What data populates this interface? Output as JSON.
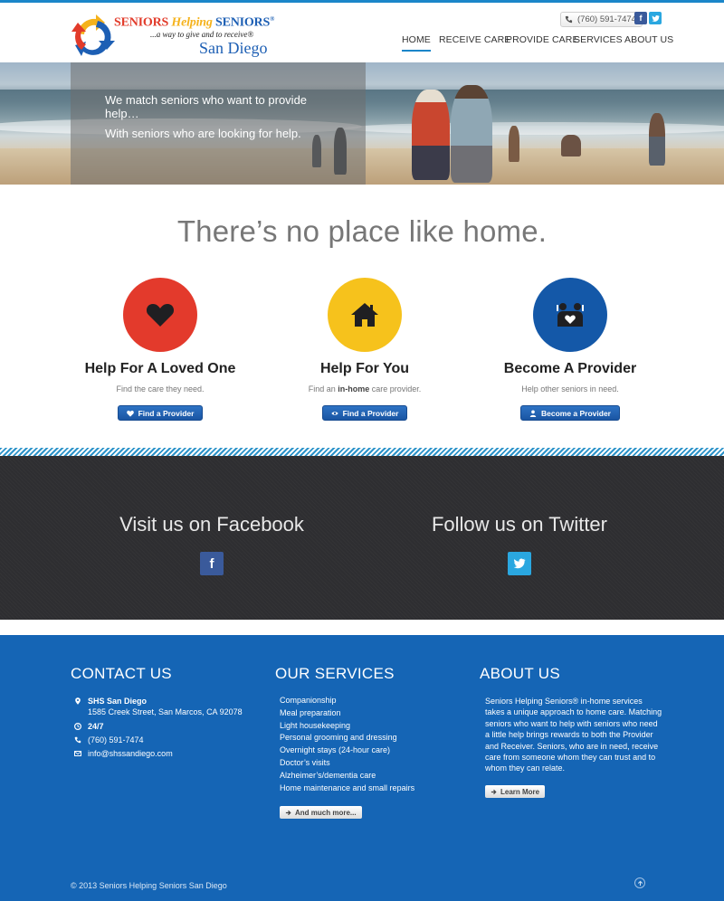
{
  "header": {
    "logo": {
      "word1": "SENIORS",
      "word2": "Helping",
      "word3": "SENIORS",
      "reg": "®",
      "tagline": "...a way to give and to receive®",
      "city": "San Diego"
    },
    "phone": "(760) 591-7474",
    "social": {
      "facebook_icon": "facebook-icon",
      "twitter_icon": "twitter-icon",
      "facebook_glyph": "f",
      "twitter_glyph": "t"
    },
    "nav": [
      {
        "label": "HOME",
        "active": true
      },
      {
        "label": "RECEIVE CARE",
        "active": false
      },
      {
        "label": "PROVIDE CARE",
        "active": false
      },
      {
        "label": "SERVICES",
        "active": false
      },
      {
        "label": "ABOUT US",
        "active": false
      }
    ]
  },
  "hero": {
    "line1": "We match seniors who want to provide help…",
    "line2": "With seniors who are looking for help."
  },
  "headline": "There’s no place like home.",
  "features": [
    {
      "title": "Help For A Loved One",
      "subtitle": "Find the care they need.",
      "button": "Find a Provider",
      "color": "#e33a2c",
      "icon": "heart-icon"
    },
    {
      "title": "Help For You",
      "subtitle_pre": "Find an ",
      "subtitle_bold": "in-home",
      "subtitle_post": " care provider.",
      "button": "Find a Provider",
      "color": "#f6c21c",
      "icon": "home-icon"
    },
    {
      "title": "Become A Provider",
      "subtitle": "Help other seniors in need.",
      "button": "Become a Provider",
      "color": "#1458a8",
      "icon": "people-icon"
    }
  ],
  "social_band": {
    "facebook_title": "Visit us on Facebook",
    "twitter_title": "Follow us on Twitter",
    "facebook_color": "#3a5a9b",
    "twitter_color": "#2aa7e0"
  },
  "footer": {
    "contact": {
      "title": "CONTACT US",
      "name": "SHS San Diego",
      "address": "1585 Creek Street, San Marcos, CA 92078",
      "hours": "24/7",
      "phone": "(760) 591-7474",
      "email": "info@shssandiego.com"
    },
    "services": {
      "title": "OUR SERVICES",
      "items": [
        "Companionship",
        "Meal preparation",
        "Light housekeeping",
        "Personal grooming and dressing",
        "Overnight stays (24-hour care)",
        "Doctor’s visits",
        "Alzheimer’s/dementia care",
        "Home maintenance and small repairs"
      ],
      "more_button": "And much more..."
    },
    "about": {
      "title": "ABOUT US",
      "text": "Seniors Helping Seniors® in-home services takes a unique approach to home care. Matching seniors who want to help with seniors who need a little help brings rewards to both the Provider and Receiver. Seniors, who are in need, receive care from someone whom they can trust and to whom they can relate.",
      "button": "Learn More"
    },
    "copyright": "© 2013 Seniors Helping Seniors San Diego",
    "accent_color": "#1565b5"
  }
}
